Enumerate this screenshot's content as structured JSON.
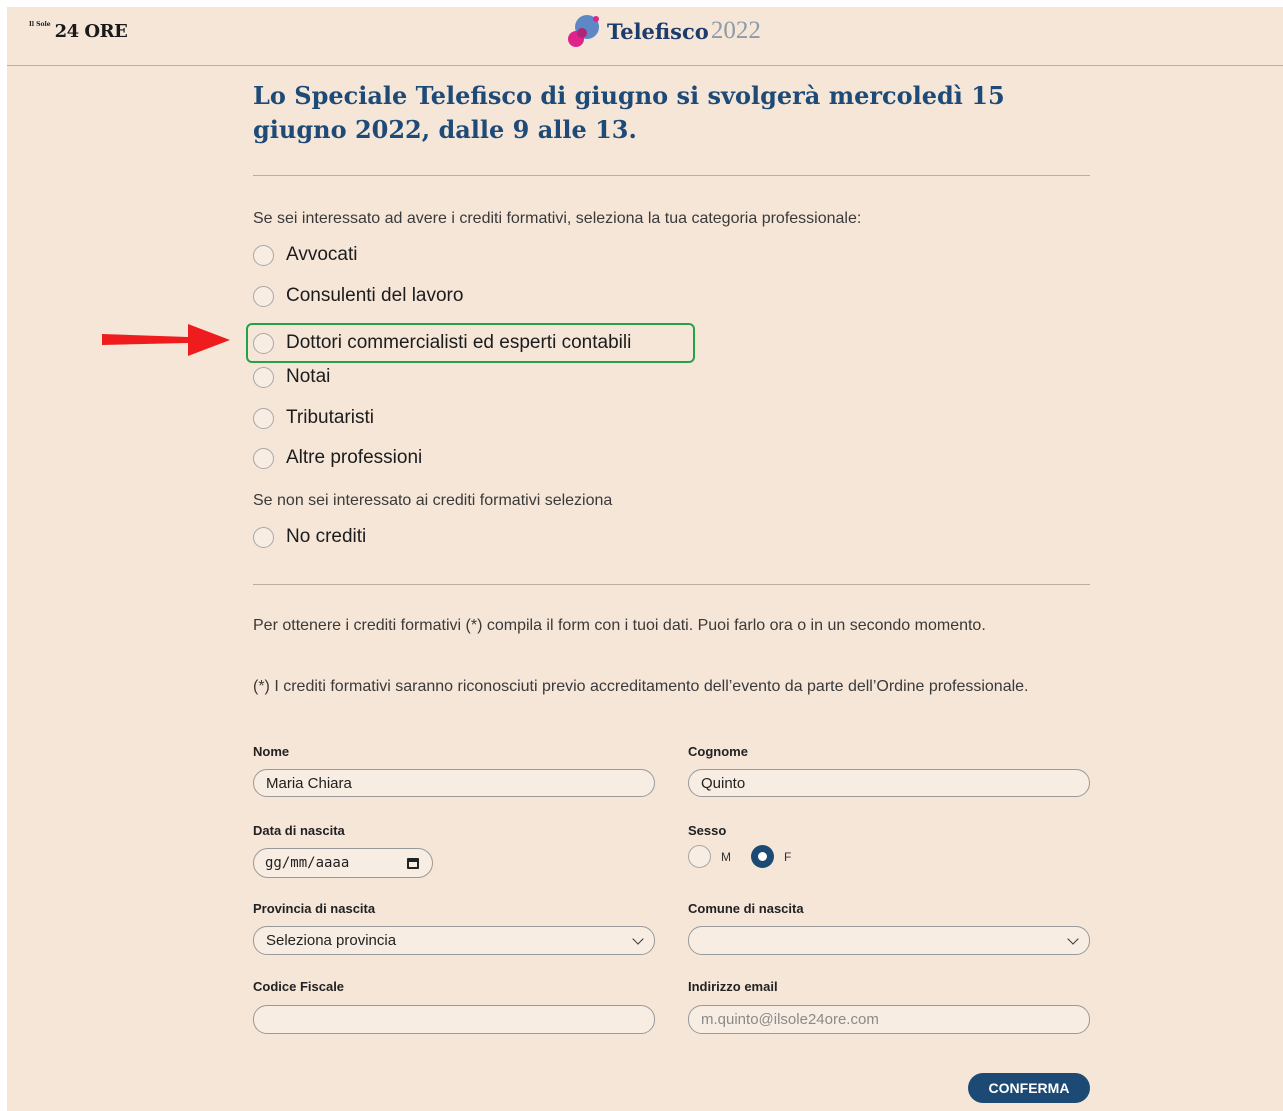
{
  "header": {
    "logo_24": "24 ORE",
    "logo_24_sup": "Il Sole",
    "brand_name": "Telefisco",
    "brand_year": "2022"
  },
  "title": "Lo Speciale Telefisco di giugno si svolgerà mercoledì 15 giugno 2022, dalle 9 alle 13.",
  "credits": {
    "prompt": "Se sei interessato ad avere i crediti formativi, seleziona la tua categoria professionale:",
    "options": [
      "Avvocati",
      "Consulenti del lavoro",
      "Dottori commercialisti ed esperti contabili",
      "Notai",
      "Tributaristi",
      "Altre professioni"
    ],
    "no_credits_prompt": "Se non sei interessato ai crediti formativi seleziona",
    "no_credits_label": "No crediti",
    "highlighted_option": "Dottori commercialisti ed esperti contabili"
  },
  "info": {
    "p1": "Per ottenere i crediti formativi (*) compila il form con i tuoi dati. Puoi farlo ora o in un secondo momento.",
    "p2": "(*) I crediti formativi saranno riconosciuti previo accreditamento dell’evento da parte dell’Ordine professionale."
  },
  "form": {
    "nome_label": "Nome",
    "nome_value": "Maria Chiara",
    "cognome_label": "Cognome",
    "cognome_value": "Quinto",
    "data_label": "Data di nascita",
    "data_placeholder": "gg/mm/aaaa",
    "sesso_label": "Sesso",
    "sesso_m": "M",
    "sesso_f": "F",
    "sesso_selected": "F",
    "provincia_label": "Provincia di nascita",
    "provincia_value": "Seleziona provincia",
    "comune_label": "Comune di nascita",
    "comune_value": "",
    "cf_label": "Codice Fiscale",
    "cf_value": "",
    "email_label": "Indirizzo email",
    "email_placeholder": "m.quinto@ilsole24ore.com",
    "submit_label": "CONFERMA"
  },
  "colors": {
    "background": "#f5e6d8",
    "title": "#1e4a78",
    "accent": "#1c4a74",
    "highlight": "#25a14a",
    "arrow": "#ee1c1c"
  },
  "icons": [
    "telefisco-logo-icon",
    "calendar-icon",
    "chevron-down-icon",
    "red-arrow-icon"
  ]
}
